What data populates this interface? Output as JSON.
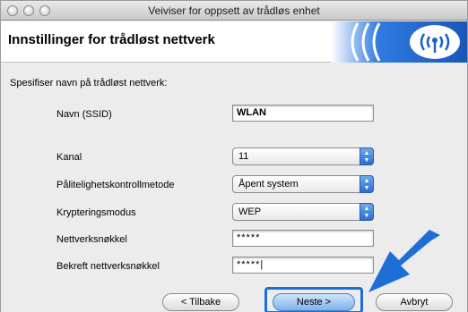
{
  "window": {
    "title": "Veiviser for oppsett av trådløs enhet"
  },
  "banner": {
    "title": "Innstillinger for trådløst nettverk",
    "logo_icon": "wireless-signal-icon",
    "accent_color": "#1f5fc8"
  },
  "form": {
    "prompt": "Spesifiser navn på trådløst nettverk:",
    "ssid": {
      "label": "Navn (SSID)",
      "value": "WLAN"
    },
    "channel": {
      "label": "Kanal",
      "value": "11"
    },
    "auth_method": {
      "label": "Pålitelighetskontrollmetode",
      "value": "Åpent system"
    },
    "encryption": {
      "label": "Krypteringsmodus",
      "value": "WEP"
    },
    "network_key": {
      "label": "Nettverksnøkkel",
      "value": "*****"
    },
    "confirm_key": {
      "label": "Bekreft nettverksnøkkel",
      "value": "*****|"
    }
  },
  "buttons": {
    "back": "< Tilbake",
    "next": "Neste >",
    "cancel": "Avbryt"
  },
  "annotation": {
    "arrow_color": "#1e6ed8"
  }
}
